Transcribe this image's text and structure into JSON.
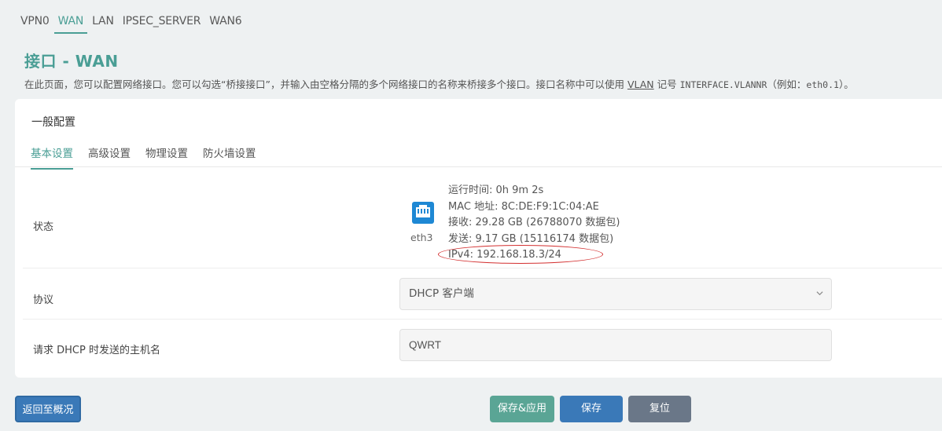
{
  "top_tabs": [
    "VPN0",
    "WAN",
    "LAN",
    "IPSEC_SERVER",
    "WAN6"
  ],
  "page": {
    "title": "接口 - WAN",
    "desc_part1": "在此页面，您可以配置网络接口。您可以勾选“桥接接口”，并输入由空格分隔的多个网络接口的名称来桥接多个接口。接口名称中可以使用 ",
    "desc_vlan": "VLAN",
    "desc_part2": " 记号 ",
    "desc_mono": "INTERFACE.VLANNR",
    "desc_part3": "（例如：",
    "desc_mono2": "eth0.1",
    "desc_part4": "）。"
  },
  "section": {
    "title": "一般配置",
    "tabs": [
      "基本设置",
      "高级设置",
      "物理设置",
      "防火墙设置"
    ]
  },
  "status": {
    "label": "状态",
    "device": "eth3",
    "uptime": "运行时间: 0h 9m 2s",
    "mac": "MAC 地址: 8C:DE:F9:1C:04:AE",
    "rx": "接收: 29.28 GB (26788070 数据包)",
    "tx": "发送: 9.17 GB (15116174 数据包)",
    "ipv4": "IPv4: 192.168.18.3/24"
  },
  "protocol": {
    "label": "协议",
    "value": "DHCP 客户端"
  },
  "hostname": {
    "label": "请求 DHCP 时发送的主机名",
    "value": "QWRT"
  },
  "buttons": {
    "back": "返回至概况",
    "save_apply": "保存&应用",
    "save": "保存",
    "reset": "复位"
  },
  "colors": {
    "accent": "#4a9e95",
    "primary": "#3a79b8",
    "highlight": "#d32f2f"
  },
  "icons": {
    "device": "ethernet-port-icon",
    "select": "chevron-down-icon"
  }
}
